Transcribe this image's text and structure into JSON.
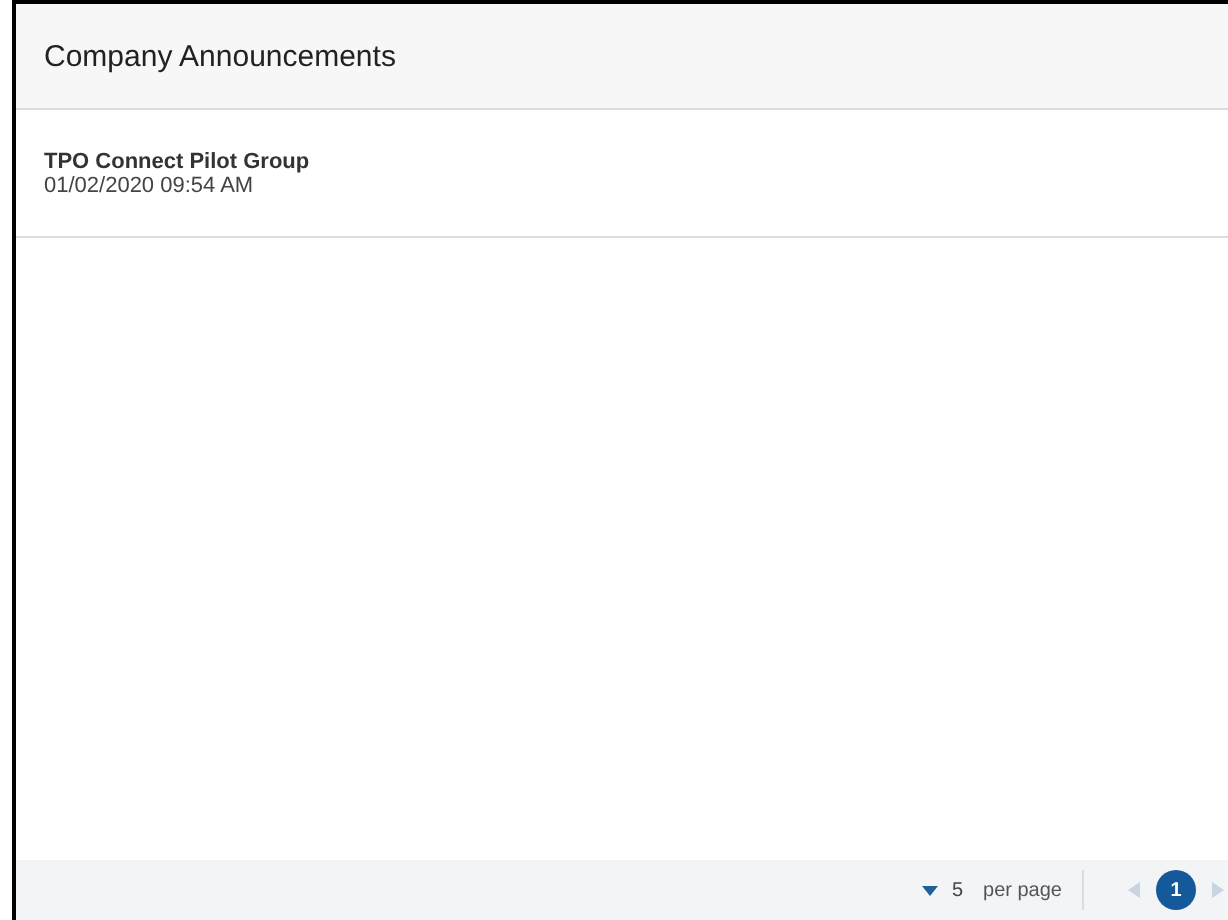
{
  "panel": {
    "title": "Company Announcements"
  },
  "announcements": [
    {
      "title": "TPO Connect Pilot Group",
      "date": "01/02/2020 09:54 AM"
    }
  ],
  "pager": {
    "page_size": "5",
    "per_page_label": "per page",
    "prev_disabled": true,
    "next_disabled": true,
    "pages": [
      {
        "label": "1",
        "selected": true
      }
    ]
  }
}
